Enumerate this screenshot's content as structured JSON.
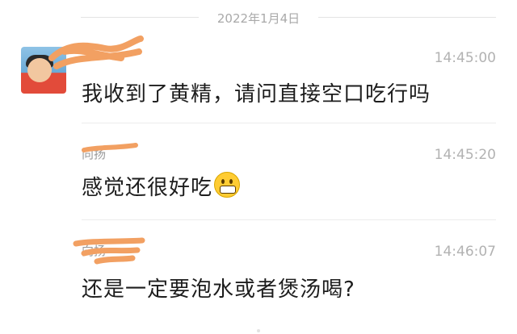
{
  "date_divider": "2022年1月4日",
  "messages": [
    {
      "sender": "",
      "time": "14:45:00",
      "text": "我收到了黄精，请问直接空口吃行吗"
    },
    {
      "sender": "向扬",
      "time": "14:45:20",
      "text": "感觉还很好吃",
      "emoji": "grinning-face-with-teeth"
    },
    {
      "sender": "向扬",
      "time": "14:46:07",
      "text": "还是一定要泡水或者煲汤喝?"
    }
  ],
  "colors": {
    "redaction": "#f2a062",
    "text": "#1d1d1d",
    "timestamp": "#b2b2b2",
    "divider": "#ececec"
  }
}
